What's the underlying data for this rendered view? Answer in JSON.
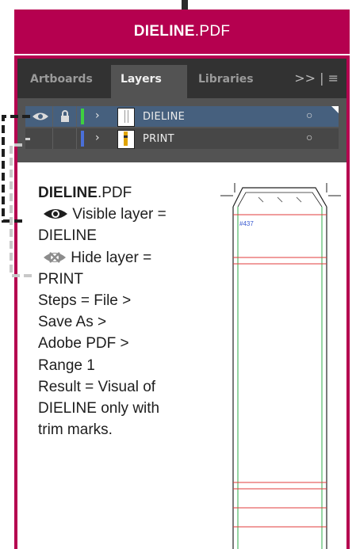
{
  "banner": {
    "name_bold": "DIELINE",
    "name_ext": ".PDF"
  },
  "panel": {
    "tabs": [
      "Artboards",
      "Layers",
      "Libraries"
    ],
    "active_tab": "Layers",
    "menu_glyph": ">> | ≡",
    "layers": [
      {
        "name": "DIELINE",
        "visible": true,
        "locked": true,
        "color": "#3fcf3f",
        "selected": true
      },
      {
        "name": "PRINT",
        "visible": false,
        "locked": false,
        "color": "#4a6fd8",
        "selected": false
      }
    ]
  },
  "instructions": {
    "title_bold": "DIELINE",
    "title_ext": ".PDF",
    "visible_label": " Visible layer =",
    "visible_value": "DIELINE",
    "hidden_label": " Hide layer =",
    "hidden_value": "PRINT",
    "steps_lines": [
      "Steps = File >",
      "Save As >",
      "Adobe PDF >",
      "Range 1"
    ],
    "result_lines": [
      "Result = Visual of",
      "DIELINE only with",
      "trim marks."
    ]
  },
  "dieline": {
    "label": "#437"
  },
  "colors": {
    "brand": "#b5004f",
    "panel_bg": "#535353",
    "selected_row": "#46607e",
    "trim_red": "#e23b3b",
    "fold_green": "#2fae4a"
  }
}
